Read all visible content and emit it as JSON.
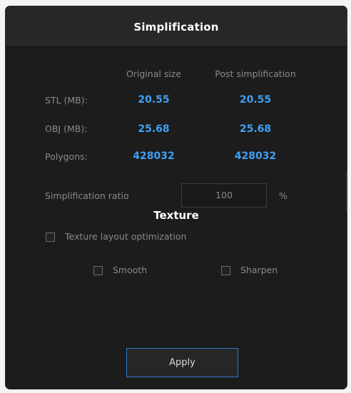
{
  "dialog": {
    "title": "Simplification"
  },
  "table": {
    "columns": [
      "Original size",
      "Post simplification"
    ],
    "rows": [
      {
        "label": "STL (MB):",
        "original": "20.55",
        "post": "20.55"
      },
      {
        "label": "OBJ (MB):",
        "original": "25.68",
        "post": "25.68"
      },
      {
        "label": "Polygons:",
        "original": "428032",
        "post": "428032"
      }
    ]
  },
  "ratio": {
    "label": "Simplification ratio",
    "value": "100",
    "unit": "%"
  },
  "texture": {
    "title": "Texture",
    "layout_optimization_label": "Texture layout optimization",
    "layout_optimization_checked": false,
    "smooth_label": "Smooth",
    "smooth_checked": false,
    "sharpen_label": "Sharpen",
    "sharpen_checked": false
  },
  "apply_label": "Apply",
  "colors": {
    "accent": "#3fa0f5",
    "background": "#1c1c1c",
    "title_bar": "#272727",
    "button_border": "#2f78c8"
  }
}
